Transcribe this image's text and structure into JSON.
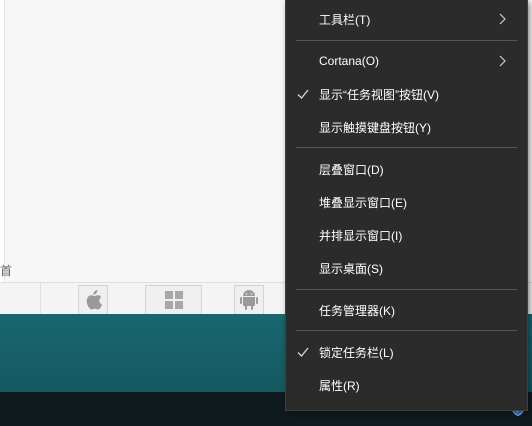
{
  "background": {
    "truncated_text": "首"
  },
  "menu": {
    "items": [
      {
        "label": "工具栏(T)",
        "submenu": true,
        "checked": false
      },
      {
        "label": "Cortana(O)",
        "submenu": true,
        "checked": false
      },
      {
        "label": "显示“任务视图”按钮(V)",
        "submenu": false,
        "checked": true
      },
      {
        "label": "显示触摸键盘按钮(Y)",
        "submenu": false,
        "checked": false
      },
      {
        "label": "层叠窗口(D)",
        "submenu": false,
        "checked": false
      },
      {
        "label": "堆叠显示窗口(E)",
        "submenu": false,
        "checked": false
      },
      {
        "label": "并排显示窗口(I)",
        "submenu": false,
        "checked": false
      },
      {
        "label": "显示桌面(S)",
        "submenu": false,
        "checked": false
      },
      {
        "label": "任务管理器(K)",
        "submenu": false,
        "checked": false
      },
      {
        "label": "锁定任务栏(L)",
        "submenu": false,
        "checked": true
      },
      {
        "label": "属性(R)",
        "submenu": false,
        "checked": false
      }
    ]
  },
  "icons": {
    "strip": [
      "apple-icon",
      "windows-icon",
      "android-icon"
    ],
    "tray": "shield-icon"
  },
  "colors": {
    "menu_bg": "#2b2b2b",
    "menu_text": "#ffffff",
    "separator": "#555555",
    "desktop": "#1a6c76",
    "taskbar": "#101b20"
  }
}
